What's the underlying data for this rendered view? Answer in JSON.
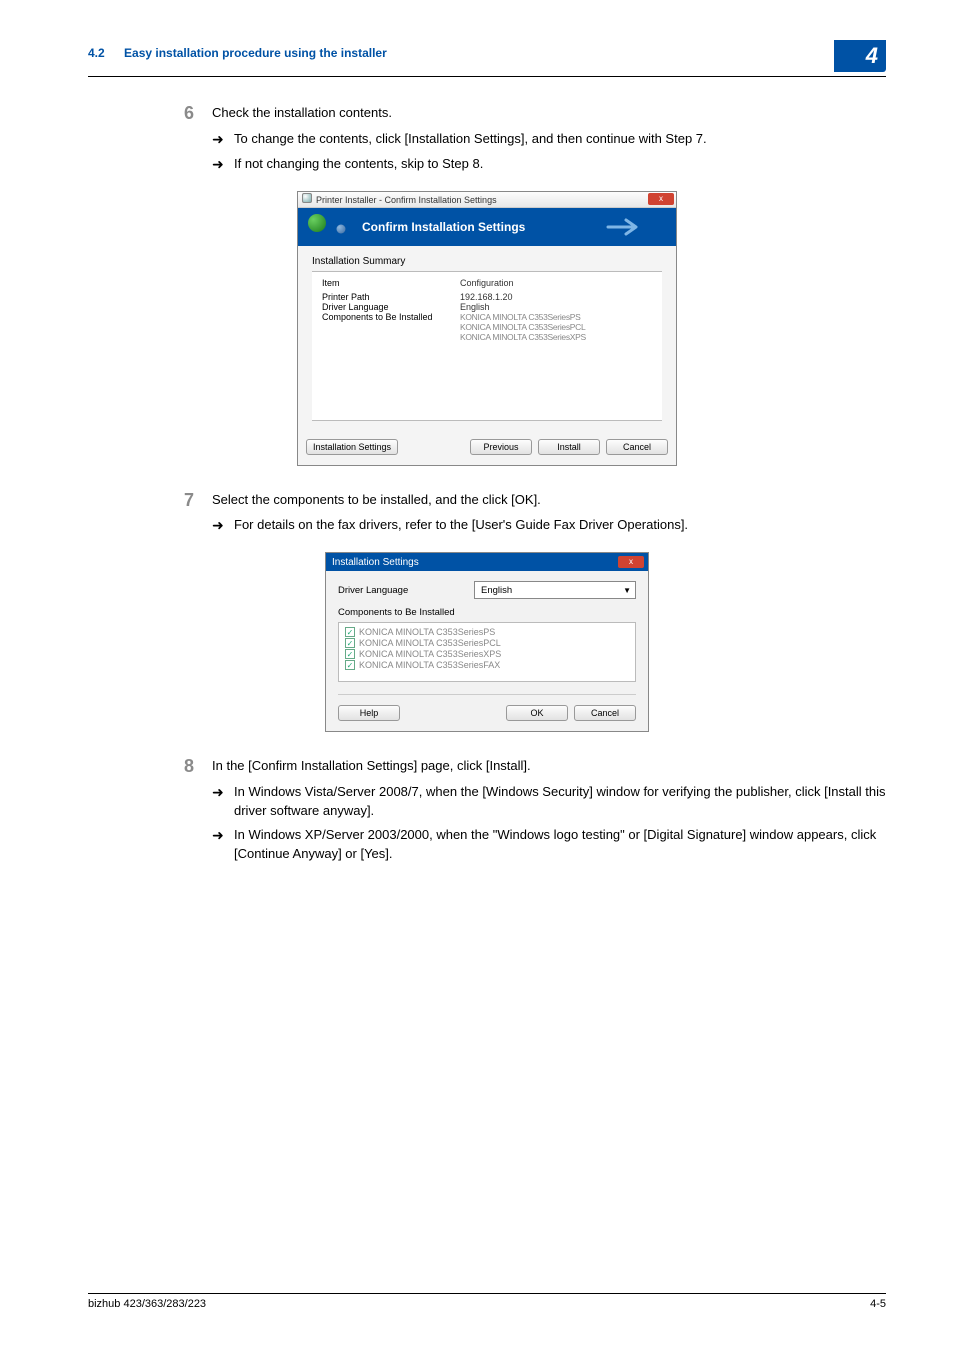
{
  "header": {
    "section_number": "4.2",
    "section_title": "Easy installation procedure using the installer",
    "chapter_number": "4"
  },
  "steps": {
    "s6": {
      "num": "6",
      "text": "Check the installation contents.",
      "sub1": "To change the contents, click [Installation Settings], and then continue with Step 7.",
      "sub2": "If not changing the contents, skip to Step 8."
    },
    "s7": {
      "num": "7",
      "text": "Select the components to be installed, and the click [OK].",
      "sub1": "For details on the fax drivers, refer to the [User's Guide Fax Driver Operations]."
    },
    "s8": {
      "num": "8",
      "text": "In the [Confirm Installation Settings] page, click [Install].",
      "sub1": "In Windows Vista/Server 2008/7, when the [Windows Security] window for verifying the publisher, click [Install this driver software anyway].",
      "sub2": "In Windows XP/Server 2003/2000, when the \"Windows logo testing\" or [Digital Signature] window appears, click [Continue Anyway] or [Yes]."
    }
  },
  "dialog1": {
    "titlebar": "Printer Installer - Confirm Installation Settings",
    "banner": "Confirm Installation Settings",
    "summary_label": "Installation Summary",
    "col_item": "Item",
    "col_config": "Configuration",
    "rows": {
      "r1a": "Printer Path",
      "r1b": "192.168.1.20",
      "r2a": "Driver Language",
      "r2b": "English",
      "r3a": "Components to Be Installed",
      "r3b1": "KONICA MINOLTA C353SeriesPS",
      "r3b2": "KONICA MINOLTA C353SeriesPCL",
      "r3b3": "KONICA MINOLTA C353SeriesXPS"
    },
    "btn_settings": "Installation Settings",
    "btn_prev": "Previous",
    "btn_install": "Install",
    "btn_cancel": "Cancel"
  },
  "dialog2": {
    "titlebar": "Installation Settings",
    "lang_label": "Driver Language",
    "lang_value": "English",
    "comp_label": "Components to Be Installed",
    "items": {
      "c1": "KONICA MINOLTA C353SeriesPS",
      "c2": "KONICA MINOLTA C353SeriesPCL",
      "c3": "KONICA MINOLTA C353SeriesXPS",
      "c4": "KONICA MINOLTA C353SeriesFAX"
    },
    "btn_help": "Help",
    "btn_ok": "OK",
    "btn_cancel": "Cancel"
  },
  "footer": {
    "left": "bizhub 423/363/283/223",
    "right": "4-5"
  },
  "glyphs": {
    "arrow": "➜",
    "check": "✓",
    "close": "x",
    "dd": "▼"
  }
}
